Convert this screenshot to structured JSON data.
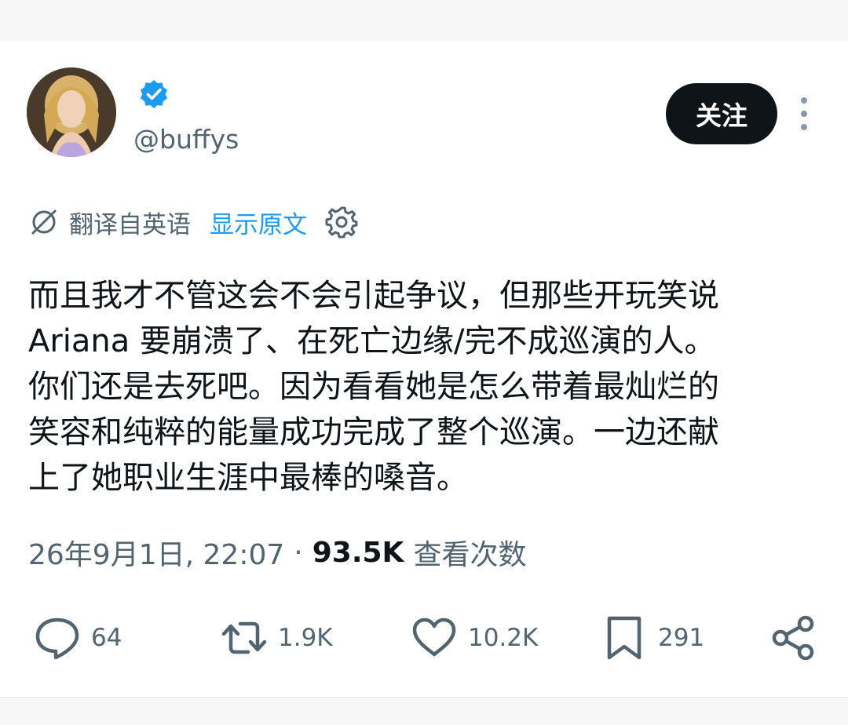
{
  "user": {
    "handle": "@buffys",
    "verified": true
  },
  "header": {
    "follow_label": "关注"
  },
  "translation": {
    "note": "翻译自英语",
    "show_original": "显示原文"
  },
  "tweet": {
    "lines": [
      "而且我才不管这会不会引起争议，但那些开玩笑说",
      "Ariana 要崩溃了、在死亡边缘/完不成巡演的人。",
      "你们还是去死吧。因为看看她是怎么带着最灿烂的",
      "笑容和纯粹的能量成功完成了整个巡演。一边还献",
      "上了她职业生涯中最棒的嗓音。"
    ]
  },
  "meta": {
    "timestamp": "26年9月1日, 22:07",
    "separator": "·",
    "views_count": "93.5K",
    "views_label": "查看次数"
  },
  "actions": {
    "replies": "64",
    "retweets": "1.9K",
    "likes": "10.2K",
    "bookmarks": "291"
  },
  "colors": {
    "accent": "#1d9bf0",
    "text": "#0f1419",
    "muted": "#536471",
    "icon": "#536471"
  }
}
